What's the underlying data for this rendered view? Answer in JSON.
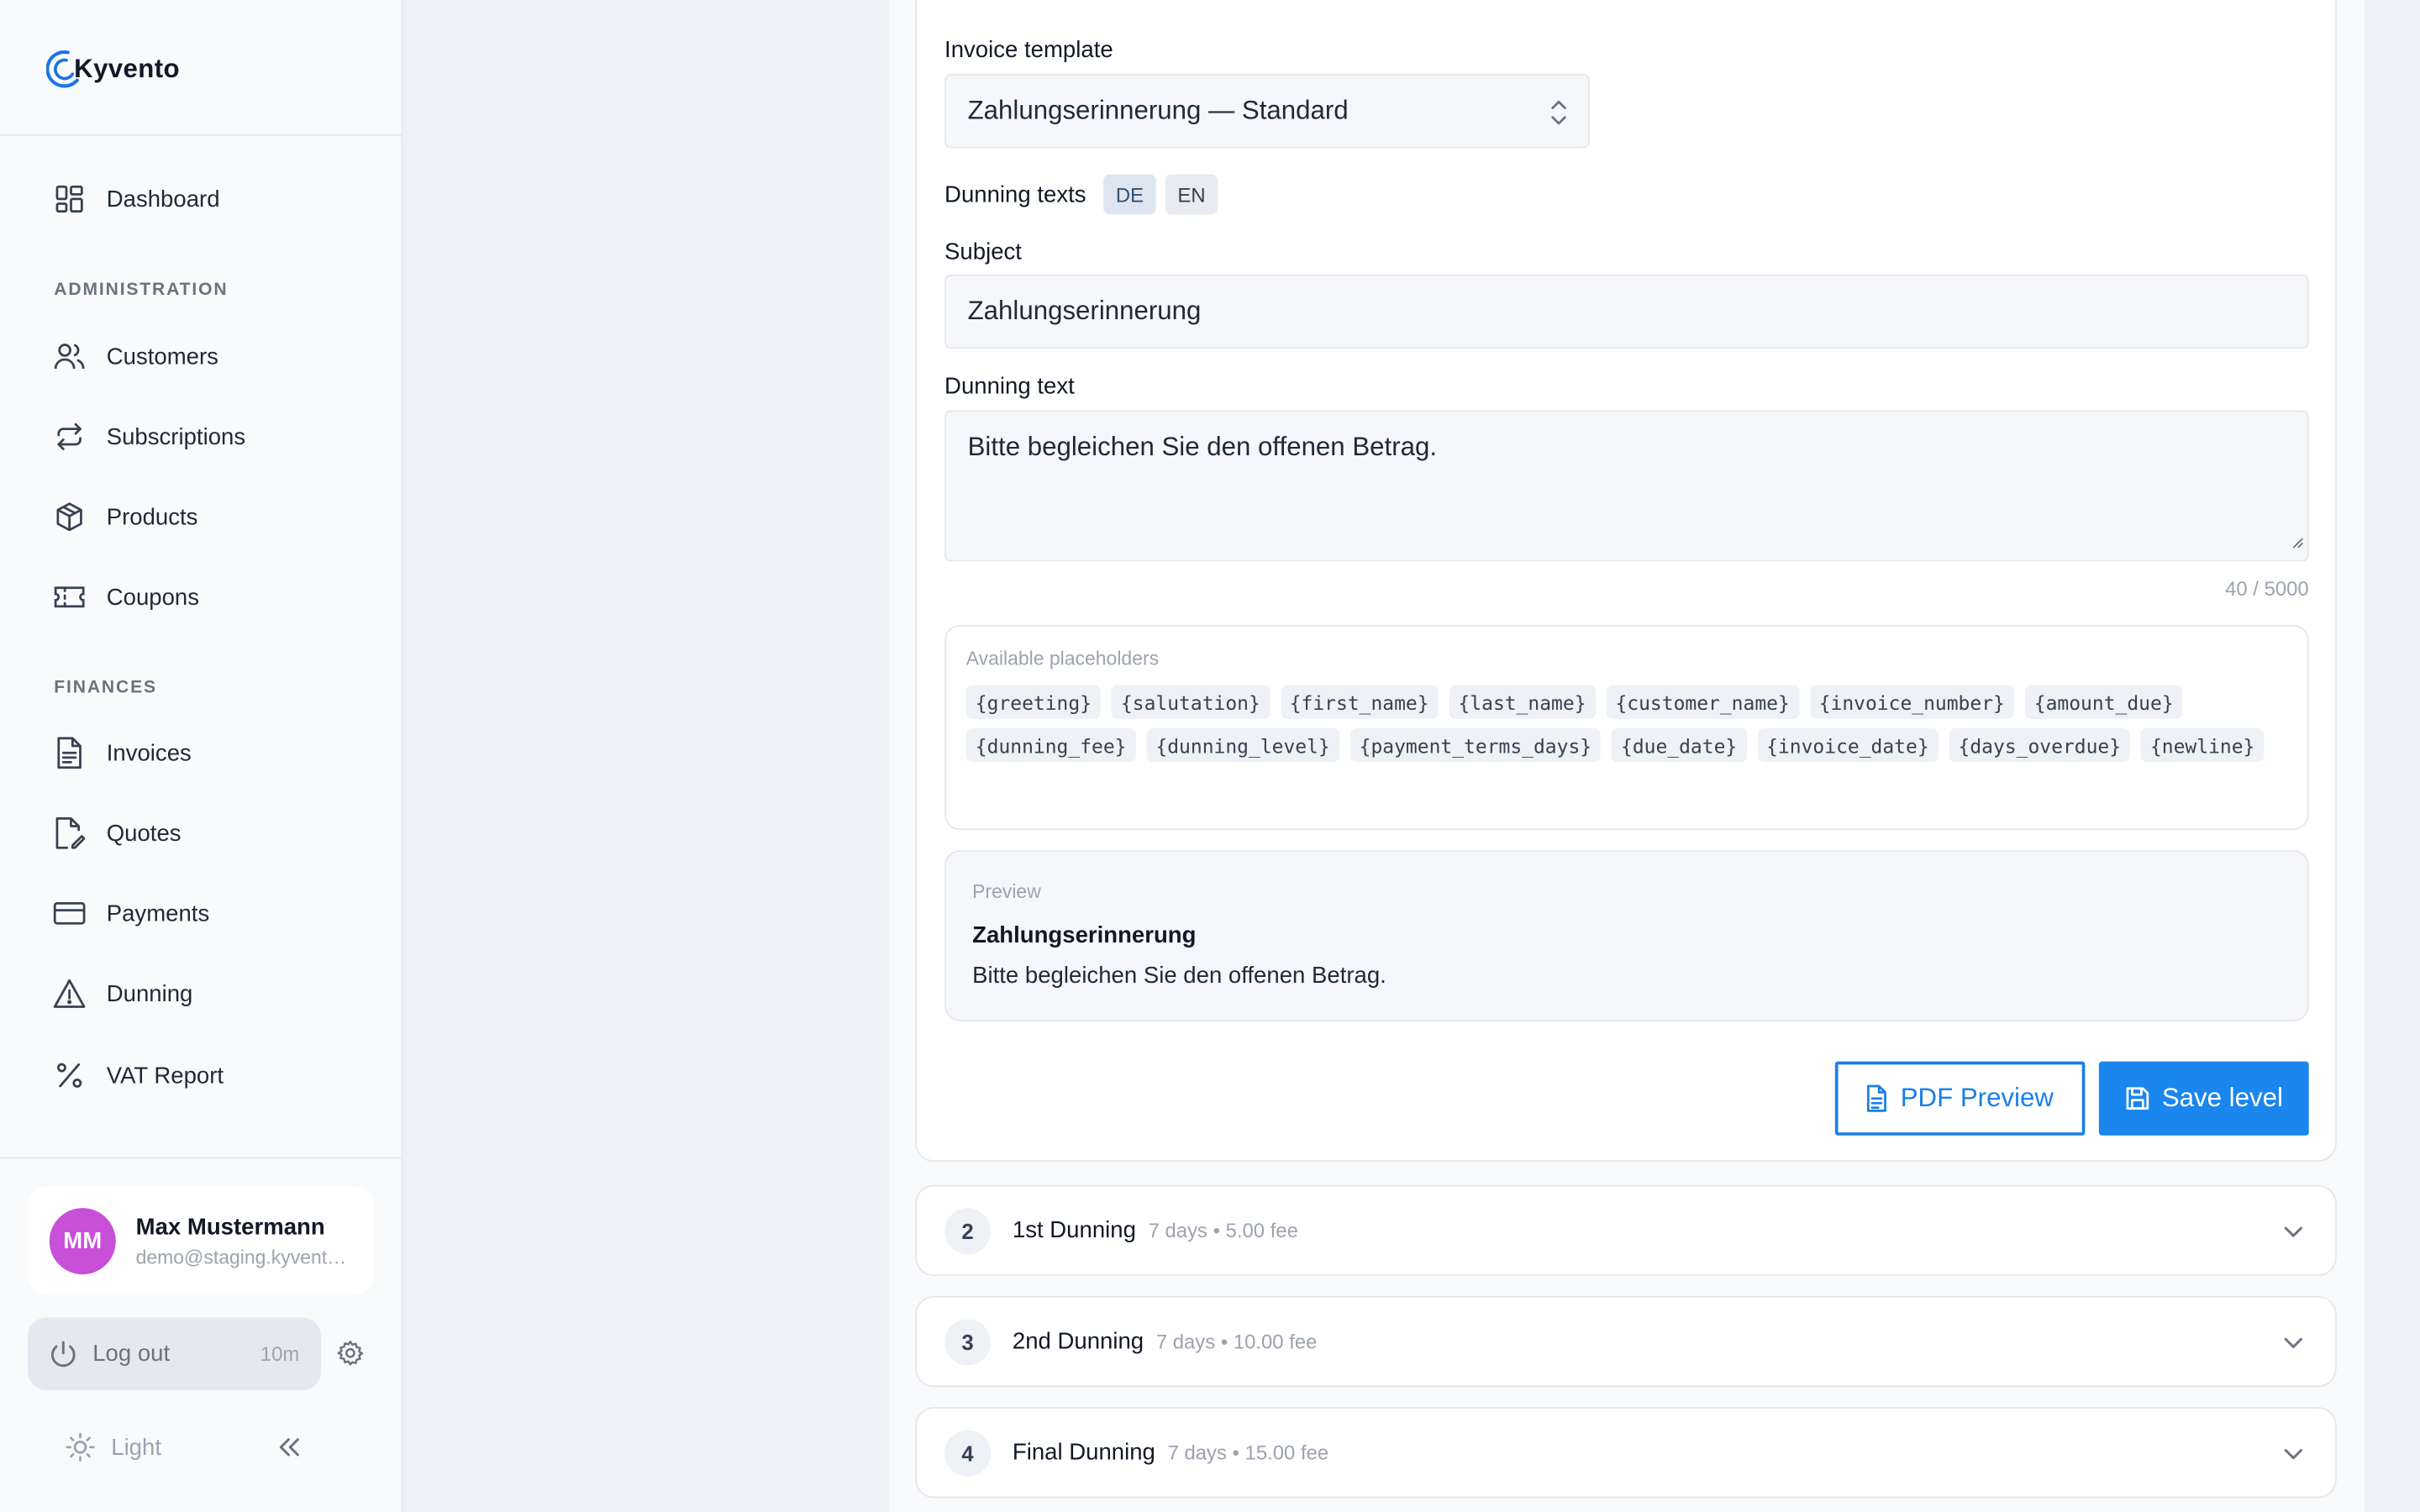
{
  "app": {
    "name": "Kyvento",
    "brand_color": "#1a86ee"
  },
  "sidebar": {
    "dashboard": "Dashboard",
    "sections": [
      {
        "title": "ADMINISTRATION",
        "items": [
          {
            "label": "Customers",
            "icon": "users-icon"
          },
          {
            "label": "Subscriptions",
            "icon": "repeat-icon"
          },
          {
            "label": "Products",
            "icon": "box-icon"
          },
          {
            "label": "Coupons",
            "icon": "ticket-icon"
          }
        ]
      },
      {
        "title": "FINANCES",
        "items": [
          {
            "label": "Invoices",
            "icon": "file-text-icon"
          },
          {
            "label": "Quotes",
            "icon": "file-edit-icon"
          },
          {
            "label": "Payments",
            "icon": "credit-card-icon"
          },
          {
            "label": "Dunning",
            "icon": "alert-triangle-icon"
          },
          {
            "label": "VAT Report",
            "icon": "percent-icon"
          }
        ]
      }
    ],
    "user": {
      "initials": "MM",
      "name": "Max Mustermann",
      "email": "demo@staging.kyvento.de",
      "avatar_color": "#c84fd8"
    },
    "logout_label": "Log out",
    "session_timer": "10m",
    "theme_label": "Light"
  },
  "form": {
    "template_label": "Invoice template",
    "template_value": "Zahlungserinnerung — Standard",
    "texts_label": "Dunning texts",
    "languages": [
      "DE",
      "EN"
    ],
    "subject_label": "Subject",
    "subject_value": "Zahlungserinnerung",
    "text_label": "Dunning text",
    "text_value": "Bitte begleichen Sie den offenen Betrag.",
    "char_counter": "40 / 5000",
    "placeholders_title": "Available placeholders",
    "placeholders": [
      "{greeting}",
      "{salutation}",
      "{first_name}",
      "{last_name}",
      "{customer_name}",
      "{invoice_number}",
      "{amount_due}",
      "{dunning_fee}",
      "{dunning_level}",
      "{payment_terms_days}",
      "{due_date}",
      "{invoice_date}",
      "{days_overdue}",
      "{newline}"
    ],
    "preview_label": "Preview",
    "preview_subject": "Zahlungserinnerung",
    "preview_body": "Bitte begleichen Sie den offenen Betrag.",
    "pdf_preview_button": "PDF Preview",
    "save_button": "Save level"
  },
  "levels": [
    {
      "number": "2",
      "name": "1st Dunning",
      "meta": "7 days • 5.00 fee"
    },
    {
      "number": "3",
      "name": "2nd Dunning",
      "meta": "7 days • 10.00 fee"
    },
    {
      "number": "4",
      "name": "Final Dunning",
      "meta": "7 days • 15.00 fee"
    }
  ]
}
